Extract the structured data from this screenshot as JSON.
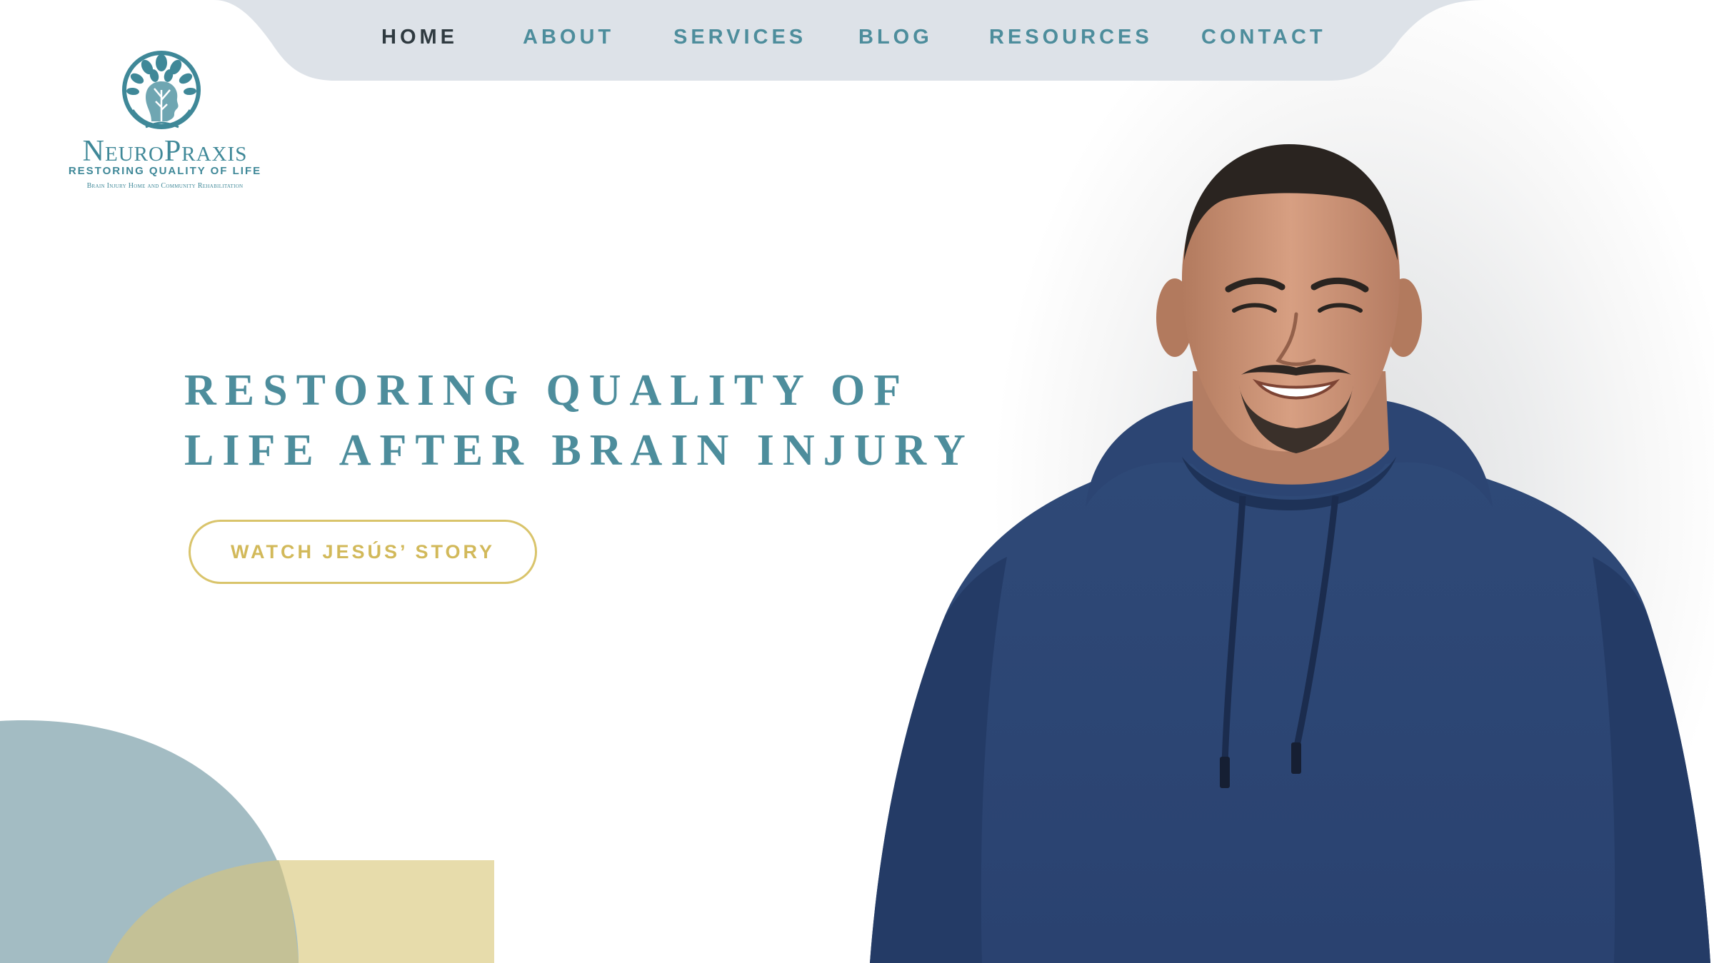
{
  "nav": {
    "items": [
      {
        "label": "HOME",
        "active": true
      },
      {
        "label": "ABOUT",
        "active": false
      },
      {
        "label": "SERVICES",
        "active": false
      },
      {
        "label": "BLOG",
        "active": false
      },
      {
        "label": "RESOURCES",
        "active": false
      },
      {
        "label": "CONTACT",
        "active": false
      }
    ]
  },
  "logo": {
    "name": "NeuroPraxis",
    "tagline": "RESTORING QUALITY OF LIFE",
    "subtitle": "Brain Injury Home and Community Rehabilitation",
    "icon": "tree-icon"
  },
  "hero": {
    "title_line1": "RESTORING QUALITY OF",
    "title_line2": "LIFE AFTER BRAIN INJURY",
    "cta_label": "WATCH JESÚS’ STORY",
    "image": "smiling-man-in-navy-hoodie"
  },
  "colors": {
    "teal": "#4d8d9c",
    "nav_bg": "#dde2e8",
    "nav_active": "#2f3a40",
    "gold": "#d9c46b",
    "deco_blue": "#a3bcc3",
    "deco_sand": "#e7dcab"
  }
}
